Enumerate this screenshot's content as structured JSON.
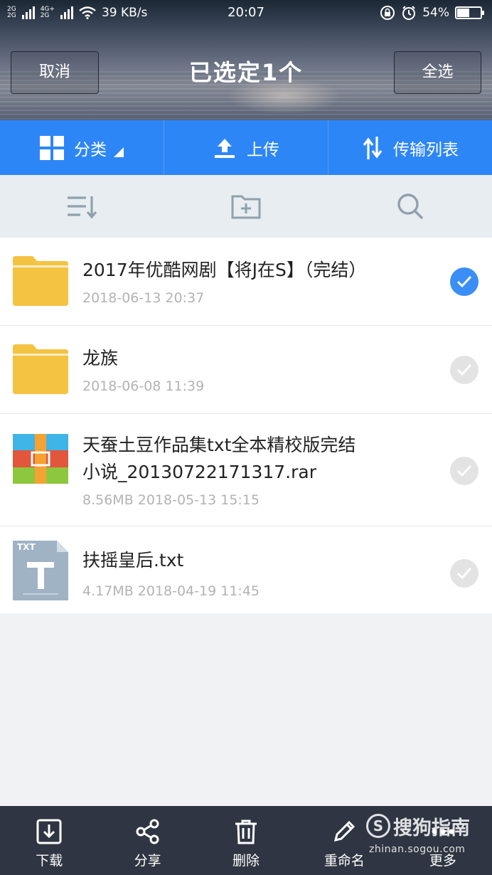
{
  "status_bar": {
    "network_left": "2G",
    "network_right": "4G+",
    "network_right2": "2G",
    "speed": "39 KB/s",
    "time": "20:07",
    "battery": "54%",
    "battery_level": 0.54
  },
  "header": {
    "cancel_label": "取消",
    "title": "已选定1个",
    "select_all_label": "全选"
  },
  "blue_toolbar": {
    "category_label": "分类",
    "upload_label": "上传",
    "transfer_label": "传输列表"
  },
  "files": [
    {
      "name": "2017年优酷网剧【将J在S】（完结）",
      "meta": "2018-06-13 20:37",
      "type": "folder",
      "selected": true
    },
    {
      "name": "龙族",
      "meta": "2018-06-08 11:39",
      "type": "folder",
      "selected": false
    },
    {
      "name_line1": "天蚕土豆作品集txt全本精校版完结",
      "name_line2": "小说_20130722171317.rar",
      "meta": "8.56MB  2018-05-13 15:15",
      "type": "rar",
      "selected": false
    },
    {
      "name": "扶摇皇后.txt",
      "meta": "4.17MB  2018-04-19 11:45",
      "type": "txt",
      "txt_badge": "TXT",
      "selected": false
    }
  ],
  "bottom_bar": {
    "download_label": "下载",
    "share_label": "分享",
    "delete_label": "删除",
    "rename_label": "重命名",
    "more_label": "更多"
  },
  "watermark": {
    "brand": "搜狗指南",
    "url": "zhinan.sogou.com",
    "logo_letter": "S"
  },
  "colors": {
    "accent_blue": "#2d86f6",
    "check_blue": "#3a8ef6",
    "folder_yellow": "#f5c342",
    "bottom_bar": "#2f3542"
  },
  "icons": {
    "sort": "sort-list-icon",
    "new_folder": "new-folder-icon",
    "search": "search-icon"
  }
}
